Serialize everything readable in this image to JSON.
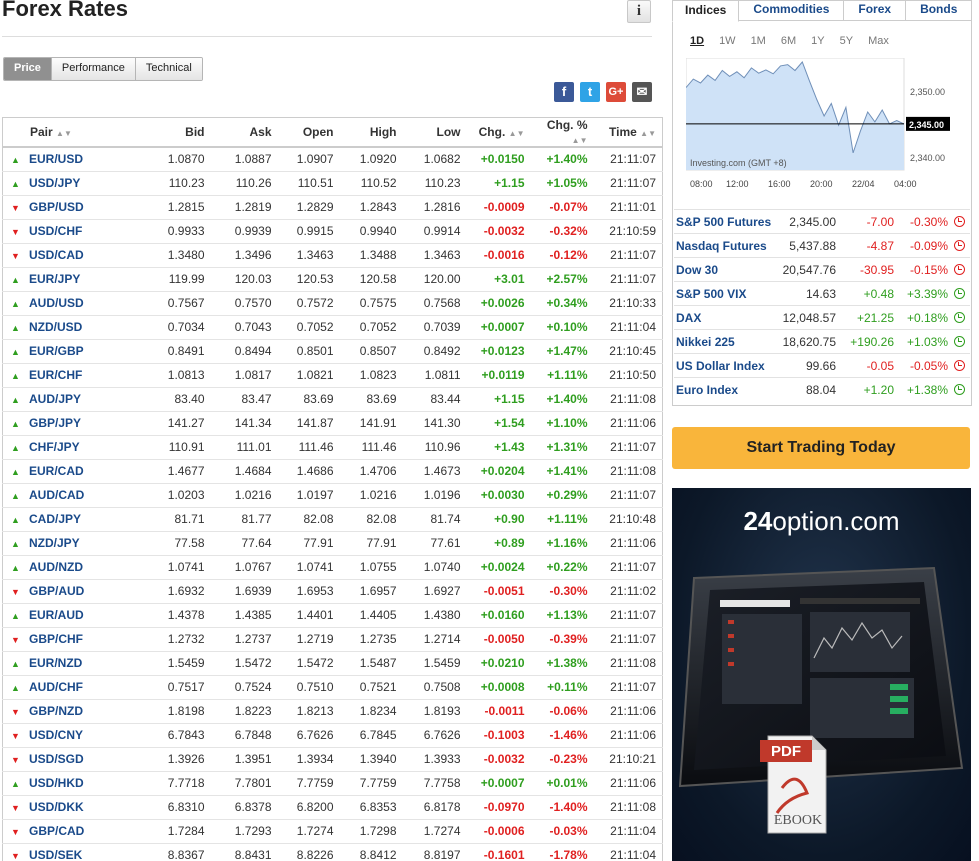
{
  "page": {
    "title": "Forex Rates",
    "info_icon_label": "i"
  },
  "view_tabs": [
    "Price",
    "Performance",
    "Technical"
  ],
  "share_icons": [
    {
      "name": "facebook-icon",
      "glyph": "f",
      "color": "#3b5998"
    },
    {
      "name": "twitter-icon",
      "glyph": "t",
      "color": "#2fa3e6"
    },
    {
      "name": "google-plus-icon",
      "glyph": "G+",
      "color": "#dd4b39"
    },
    {
      "name": "email-icon",
      "glyph": "✉",
      "color": "#555555"
    }
  ],
  "table": {
    "headers": [
      "Pair",
      "Bid",
      "Ask",
      "Open",
      "High",
      "Low",
      "Chg.",
      "Chg. %",
      "Time"
    ],
    "rows": [
      {
        "dir": "up",
        "pair": "EUR/USD",
        "bid": "1.0870",
        "ask": "1.0887",
        "open": "1.0907",
        "high": "1.0920",
        "low": "1.0682",
        "chg": "+0.0150",
        "pct": "+1.40%",
        "time": "21:11:07"
      },
      {
        "dir": "up",
        "pair": "USD/JPY",
        "bid": "110.23",
        "ask": "110.26",
        "open": "110.51",
        "high": "110.52",
        "low": "110.23",
        "chg": "+1.15",
        "pct": "+1.05%",
        "time": "21:11:07"
      },
      {
        "dir": "dn",
        "pair": "GBP/USD",
        "bid": "1.2815",
        "ask": "1.2819",
        "open": "1.2829",
        "high": "1.2843",
        "low": "1.2816",
        "chg": "-0.0009",
        "pct": "-0.07%",
        "time": "21:11:01"
      },
      {
        "dir": "dn",
        "pair": "USD/CHF",
        "bid": "0.9933",
        "ask": "0.9939",
        "open": "0.9915",
        "high": "0.9940",
        "low": "0.9914",
        "chg": "-0.0032",
        "pct": "-0.32%",
        "time": "21:10:59"
      },
      {
        "dir": "dn",
        "pair": "USD/CAD",
        "bid": "1.3480",
        "ask": "1.3496",
        "open": "1.3463",
        "high": "1.3488",
        "low": "1.3463",
        "chg": "-0.0016",
        "pct": "-0.12%",
        "time": "21:11:07"
      },
      {
        "dir": "up",
        "pair": "EUR/JPY",
        "bid": "119.99",
        "ask": "120.03",
        "open": "120.53",
        "high": "120.58",
        "low": "120.00",
        "chg": "+3.01",
        "pct": "+2.57%",
        "time": "21:11:07"
      },
      {
        "dir": "up",
        "pair": "AUD/USD",
        "bid": "0.7567",
        "ask": "0.7570",
        "open": "0.7572",
        "high": "0.7575",
        "low": "0.7568",
        "chg": "+0.0026",
        "pct": "+0.34%",
        "time": "21:10:33"
      },
      {
        "dir": "up",
        "pair": "NZD/USD",
        "bid": "0.7034",
        "ask": "0.7043",
        "open": "0.7052",
        "high": "0.7052",
        "low": "0.7039",
        "chg": "+0.0007",
        "pct": "+0.10%",
        "time": "21:11:04"
      },
      {
        "dir": "up",
        "pair": "EUR/GBP",
        "bid": "0.8491",
        "ask": "0.8494",
        "open": "0.8501",
        "high": "0.8507",
        "low": "0.8492",
        "chg": "+0.0123",
        "pct": "+1.47%",
        "time": "21:10:45"
      },
      {
        "dir": "up",
        "pair": "EUR/CHF",
        "bid": "1.0813",
        "ask": "1.0817",
        "open": "1.0821",
        "high": "1.0823",
        "low": "1.0811",
        "chg": "+0.0119",
        "pct": "+1.11%",
        "time": "21:10:50"
      },
      {
        "dir": "up",
        "pair": "AUD/JPY",
        "bid": "83.40",
        "ask": "83.47",
        "open": "83.69",
        "high": "83.69",
        "low": "83.44",
        "chg": "+1.15",
        "pct": "+1.40%",
        "time": "21:11:08"
      },
      {
        "dir": "up",
        "pair": "GBP/JPY",
        "bid": "141.27",
        "ask": "141.34",
        "open": "141.87",
        "high": "141.91",
        "low": "141.30",
        "chg": "+1.54",
        "pct": "+1.10%",
        "time": "21:11:06"
      },
      {
        "dir": "up",
        "pair": "CHF/JPY",
        "bid": "110.91",
        "ask": "111.01",
        "open": "111.46",
        "high": "111.46",
        "low": "110.96",
        "chg": "+1.43",
        "pct": "+1.31%",
        "time": "21:11:07"
      },
      {
        "dir": "up",
        "pair": "EUR/CAD",
        "bid": "1.4677",
        "ask": "1.4684",
        "open": "1.4686",
        "high": "1.4706",
        "low": "1.4673",
        "chg": "+0.0204",
        "pct": "+1.41%",
        "time": "21:11:08"
      },
      {
        "dir": "up",
        "pair": "AUD/CAD",
        "bid": "1.0203",
        "ask": "1.0216",
        "open": "1.0197",
        "high": "1.0216",
        "low": "1.0196",
        "chg": "+0.0030",
        "pct": "+0.29%",
        "time": "21:11:07"
      },
      {
        "dir": "up",
        "pair": "CAD/JPY",
        "bid": "81.71",
        "ask": "81.77",
        "open": "82.08",
        "high": "82.08",
        "low": "81.74",
        "chg": "+0.90",
        "pct": "+1.11%",
        "time": "21:10:48"
      },
      {
        "dir": "up",
        "pair": "NZD/JPY",
        "bid": "77.58",
        "ask": "77.64",
        "open": "77.91",
        "high": "77.91",
        "low": "77.61",
        "chg": "+0.89",
        "pct": "+1.16%",
        "time": "21:11:06"
      },
      {
        "dir": "up",
        "pair": "AUD/NZD",
        "bid": "1.0741",
        "ask": "1.0767",
        "open": "1.0741",
        "high": "1.0755",
        "low": "1.0740",
        "chg": "+0.0024",
        "pct": "+0.22%",
        "time": "21:11:07"
      },
      {
        "dir": "dn",
        "pair": "GBP/AUD",
        "bid": "1.6932",
        "ask": "1.6939",
        "open": "1.6953",
        "high": "1.6957",
        "low": "1.6927",
        "chg": "-0.0051",
        "pct": "-0.30%",
        "time": "21:11:02"
      },
      {
        "dir": "up",
        "pair": "EUR/AUD",
        "bid": "1.4378",
        "ask": "1.4385",
        "open": "1.4401",
        "high": "1.4405",
        "low": "1.4380",
        "chg": "+0.0160",
        "pct": "+1.13%",
        "time": "21:11:07"
      },
      {
        "dir": "dn",
        "pair": "GBP/CHF",
        "bid": "1.2732",
        "ask": "1.2737",
        "open": "1.2719",
        "high": "1.2735",
        "low": "1.2714",
        "chg": "-0.0050",
        "pct": "-0.39%",
        "time": "21:11:07"
      },
      {
        "dir": "up",
        "pair": "EUR/NZD",
        "bid": "1.5459",
        "ask": "1.5472",
        "open": "1.5472",
        "high": "1.5487",
        "low": "1.5459",
        "chg": "+0.0210",
        "pct": "+1.38%",
        "time": "21:11:08"
      },
      {
        "dir": "up",
        "pair": "AUD/CHF",
        "bid": "0.7517",
        "ask": "0.7524",
        "open": "0.7510",
        "high": "0.7521",
        "low": "0.7508",
        "chg": "+0.0008",
        "pct": "+0.11%",
        "time": "21:11:07"
      },
      {
        "dir": "dn",
        "pair": "GBP/NZD",
        "bid": "1.8198",
        "ask": "1.8223",
        "open": "1.8213",
        "high": "1.8234",
        "low": "1.8193",
        "chg": "-0.0011",
        "pct": "-0.06%",
        "time": "21:11:06"
      },
      {
        "dir": "dn",
        "pair": "USD/CNY",
        "bid": "6.7843",
        "ask": "6.7848",
        "open": "6.7626",
        "high": "6.7845",
        "low": "6.7626",
        "chg": "-0.1003",
        "pct": "-1.46%",
        "time": "21:11:06"
      },
      {
        "dir": "dn",
        "pair": "USD/SGD",
        "bid": "1.3926",
        "ask": "1.3951",
        "open": "1.3934",
        "high": "1.3940",
        "low": "1.3933",
        "chg": "-0.0032",
        "pct": "-0.23%",
        "time": "21:10:21"
      },
      {
        "dir": "up",
        "pair": "USD/HKD",
        "bid": "7.7718",
        "ask": "7.7801",
        "open": "7.7759",
        "high": "7.7759",
        "low": "7.7758",
        "chg": "+0.0007",
        "pct": "+0.01%",
        "time": "21:11:06"
      },
      {
        "dir": "dn",
        "pair": "USD/DKK",
        "bid": "6.8310",
        "ask": "6.8378",
        "open": "6.8200",
        "high": "6.8353",
        "low": "6.8178",
        "chg": "-0.0970",
        "pct": "-1.40%",
        "time": "21:11:08"
      },
      {
        "dir": "dn",
        "pair": "GBP/CAD",
        "bid": "1.7284",
        "ask": "1.7293",
        "open": "1.7274",
        "high": "1.7298",
        "low": "1.7274",
        "chg": "-0.0006",
        "pct": "-0.03%",
        "time": "21:11:04"
      },
      {
        "dir": "dn",
        "pair": "USD/SEK",
        "bid": "8.8367",
        "ask": "8.8431",
        "open": "8.8226",
        "high": "8.8412",
        "low": "8.8197",
        "chg": "-0.1601",
        "pct": "-1.78%",
        "time": "21:11:04"
      }
    ]
  },
  "market_tabs": [
    "Indices",
    "Commodities",
    "Forex",
    "Bonds"
  ],
  "range_buttons": [
    "1D",
    "1W",
    "1M",
    "6M",
    "1Y",
    "5Y",
    "Max"
  ],
  "chart_data": {
    "type": "area",
    "x_ticks": [
      "08:00",
      "12:00",
      "16:00",
      "20:00",
      "22/04",
      "04:00"
    ],
    "y_ticks": [
      "2,350.00",
      "2,340.00"
    ],
    "current_value": "2,345.00",
    "source_label": "Investing.com (GMT +8)",
    "ylim": [
      2338,
      2355
    ],
    "series": [
      {
        "values": [
          2350.5,
          2351.8,
          2351.2,
          2352.4,
          2351.6,
          2353.1,
          2352.2,
          2352.9,
          2352.0,
          2353.5,
          2352.7,
          2353.2,
          2352.6,
          2353.8,
          2354.0,
          2353.1,
          2354.4,
          2351.5,
          2348.7,
          2346.2,
          2348.1,
          2344.8,
          2347.5,
          2340.6,
          2343.9,
          2346.8,
          2345.3,
          2347.1,
          2345.0,
          2345.5,
          2345.0
        ]
      }
    ]
  },
  "indices": [
    {
      "name": "S&P 500 Futures",
      "last": "2,345.00",
      "chg": "-7.00",
      "pct": "-0.30%",
      "dir": "neg"
    },
    {
      "name": "Nasdaq Futures",
      "last": "5,437.88",
      "chg": "-4.87",
      "pct": "-0.09%",
      "dir": "neg"
    },
    {
      "name": "Dow 30",
      "last": "20,547.76",
      "chg": "-30.95",
      "pct": "-0.15%",
      "dir": "neg"
    },
    {
      "name": "S&P 500 VIX",
      "last": "14.63",
      "chg": "+0.48",
      "pct": "+3.39%",
      "dir": "pos"
    },
    {
      "name": "DAX",
      "last": "12,048.57",
      "chg": "+21.25",
      "pct": "+0.18%",
      "dir": "pos"
    },
    {
      "name": "Nikkei 225",
      "last": "18,620.75",
      "chg": "+190.26",
      "pct": "+1.03%",
      "dir": "pos"
    },
    {
      "name": "US Dollar Index",
      "last": "99.66",
      "chg": "-0.05",
      "pct": "-0.05%",
      "dir": "neg"
    },
    {
      "name": "Euro Index",
      "last": "88.04",
      "chg": "+1.20",
      "pct": "+1.38%",
      "dir": "pos"
    }
  ],
  "cta": {
    "label": "Start Trading Today",
    "color": "#f9b53b"
  },
  "ad": {
    "brand_prefix": "24",
    "brand_suffix": "option.com",
    "badge_pdf": "PDF",
    "badge_ebook": "EBOOK"
  },
  "colors": {
    "up": "#2f9e1f",
    "down": "#e02020",
    "link": "#1a4a8a"
  }
}
